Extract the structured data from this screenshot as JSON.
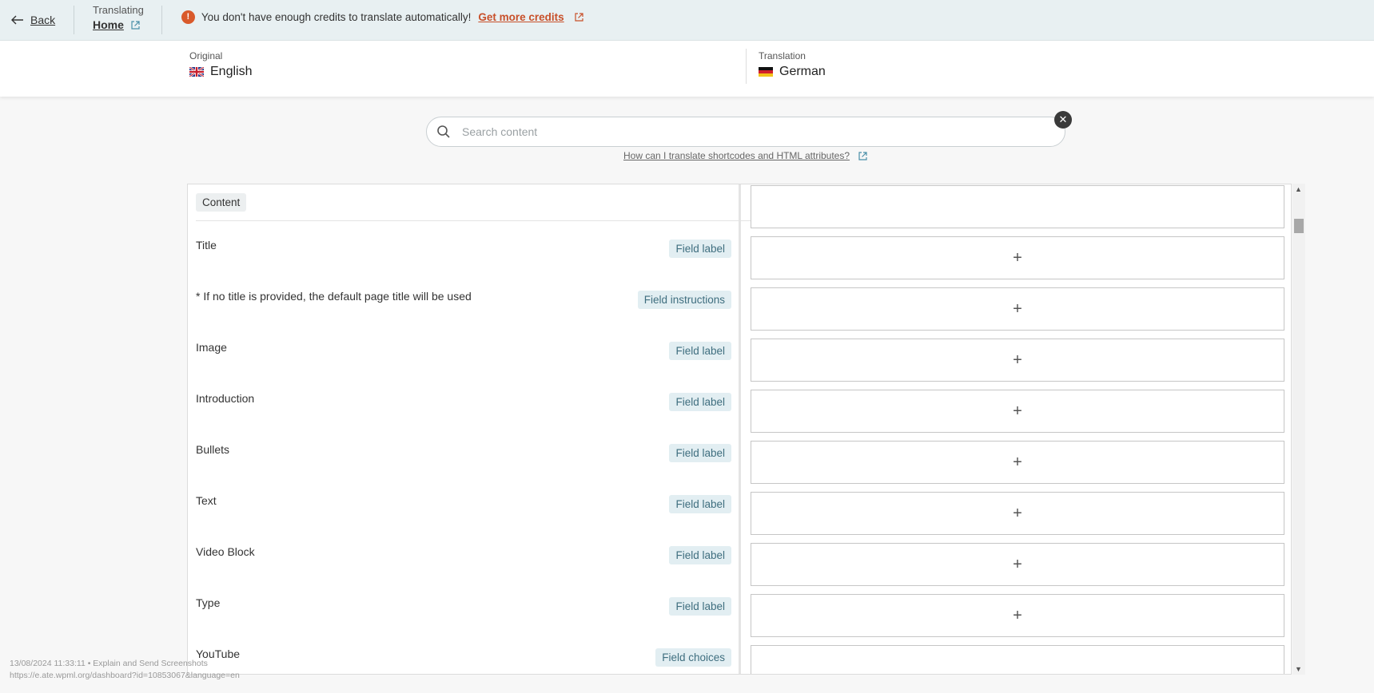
{
  "topbar": {
    "back_label": "Back",
    "translating_label": "Translating",
    "page_name": "Home",
    "warning_text": "You don't have enough credits to translate automatically!",
    "warning_link": "Get more credits"
  },
  "languages": {
    "original_label": "Original",
    "original_value": "English",
    "translation_label": "Translation",
    "translation_value": "German"
  },
  "search": {
    "placeholder": "Search content",
    "help_link": "How can I translate shortcodes and HTML attributes?"
  },
  "panel": {
    "section_label": "Content",
    "rows": [
      {
        "source": "Title",
        "tag": "Field label"
      },
      {
        "source": "* If no title is provided, the default page title will be used",
        "tag": "Field instructions"
      },
      {
        "source": "Image",
        "tag": "Field label"
      },
      {
        "source": "Introduction",
        "tag": "Field label"
      },
      {
        "source": "Bullets",
        "tag": "Field label"
      },
      {
        "source": "Text",
        "tag": "Field label"
      },
      {
        "source": "Video Block",
        "tag": "Field label"
      },
      {
        "source": "Type",
        "tag": "Field label"
      },
      {
        "source": "YouTube",
        "tag": "Field choices"
      }
    ],
    "add_symbol": "+"
  },
  "overlay": {
    "line1": "13/08/2024 11:33:11 • Explain and Send Screenshots",
    "line2": "https://e.ate.wpml.org/dashboard?id=10853067&language=en"
  },
  "colors": {
    "accent_warning": "#d95a2b",
    "tag_text": "#3f6e7f",
    "tag_bg": "#e2eef2"
  }
}
